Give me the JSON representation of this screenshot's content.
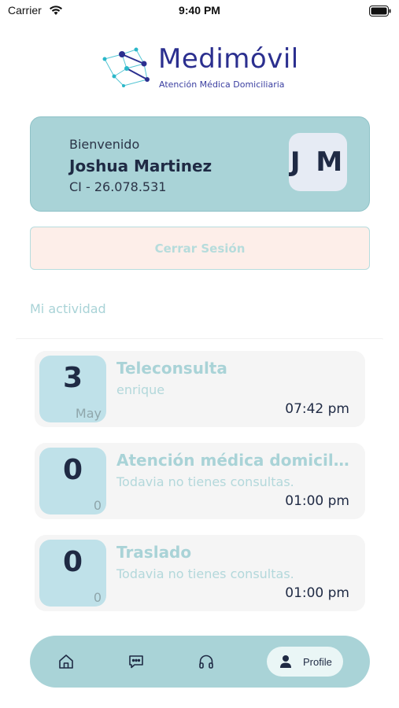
{
  "status_bar": {
    "carrier": "Carrier",
    "time": "9:40 PM"
  },
  "logo": {
    "title": "Medimóvil",
    "subtitle": "Atención Médica Domiciliaria"
  },
  "welcome": {
    "greeting": "Bienvenido",
    "name": "Joshua Martinez",
    "ci": "CI - 26.078.531",
    "initials": "J M"
  },
  "logout_label": "Cerrar Sesión",
  "section_title": "Mi actividad",
  "activities": [
    {
      "day": "3",
      "month": "May",
      "title": "Teleconsulta",
      "description": "enrique",
      "time": "07:42 pm"
    },
    {
      "day": "0",
      "month": "0",
      "title": "Atención médica domiciliaria",
      "description": "Todavia no tienes consultas.",
      "time": "01:00 pm"
    },
    {
      "day": "0",
      "month": "0",
      "title": "Traslado",
      "description": "Todavia no tienes consultas.",
      "time": "01:00 pm"
    }
  ],
  "nav": {
    "items": [
      {
        "icon": "home-icon"
      },
      {
        "icon": "chat-icon"
      },
      {
        "icon": "headphones-icon"
      }
    ],
    "profile_label": "Profile",
    "profile_icon": "person-icon"
  },
  "colors": {
    "accent": "#a9d3d7",
    "dark": "#1f2a44",
    "logout_bg": "#fdeee9",
    "date_bg": "#bfe1e9"
  }
}
